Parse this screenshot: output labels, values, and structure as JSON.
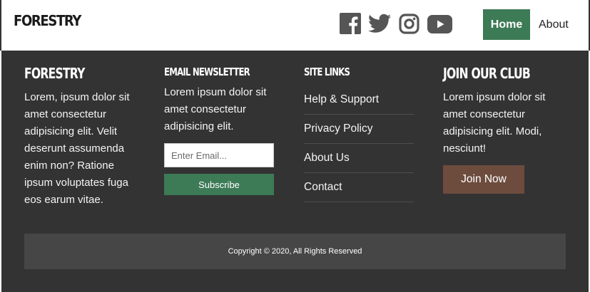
{
  "header": {
    "brand": "FORESTRY",
    "socials": [
      {
        "name": "facebook-icon",
        "color": "#555555"
      },
      {
        "name": "twitter-icon",
        "color": "#555555"
      },
      {
        "name": "instagram-icon",
        "color": "#555555"
      },
      {
        "name": "youtube-icon",
        "color": "#555555"
      }
    ],
    "nav": {
      "home": "Home",
      "about": "About",
      "active_color": "#3d7a56"
    }
  },
  "footer": {
    "about": {
      "title": "FORESTRY",
      "text": "Lorem, ipsum dolor sit amet consectetur adipisicing elit. Velit deserunt assumenda enim non? Ratione ipsum voluptates fuga eos earum vitae."
    },
    "newsletter": {
      "title": "Email Newsletter",
      "text": "Lorem ipsum dolor sit amet consectetur adipisicing elit.",
      "email_placeholder": "Enter Email...",
      "subscribe_label": "Subscribe"
    },
    "site_links": {
      "title": "Site Links",
      "items": [
        "Help & Support",
        "Privacy Policy",
        "About Us",
        "Contact"
      ]
    },
    "club": {
      "title": "Join Our Club",
      "text": "Lorem ipsum dolor sit amet consectetur adipisicing elit. Modi, nesciunt!",
      "join_label": "Join Now",
      "button_color": "#6d4c3e"
    },
    "copyright": "Copyright © 2020, All Rights Reserved",
    "background_color": "#333333"
  }
}
